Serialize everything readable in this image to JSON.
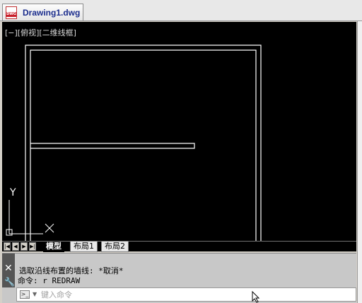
{
  "document": {
    "file_tab_label": "Drawing1.dwg",
    "file_icon": "dwg-file-icon",
    "file_icon_text": "DWG"
  },
  "viewport": {
    "view_label": "[−][俯视][二维线框]",
    "background": "#000000",
    "line_color": "#ffffff",
    "ucs": {
      "y_label": "Y",
      "x_label": "X"
    }
  },
  "layout_tabs": {
    "nav_buttons": [
      "first",
      "previous",
      "next",
      "last"
    ],
    "tabs": [
      {
        "label": "模型",
        "active": true
      },
      {
        "label": "布局1",
        "active": false
      },
      {
        "label": "布局2",
        "active": false
      }
    ]
  },
  "command_line": {
    "history": [
      "选取沿线布置的墙线: *取消*",
      "命令: r REDRAW"
    ],
    "placeholder": "键入命令",
    "close_icon": "close-icon",
    "customize_icon": "wrench-icon"
  },
  "colors": {
    "tab_name": "#1a2c8c",
    "dwg_icon": "#c8202a"
  }
}
